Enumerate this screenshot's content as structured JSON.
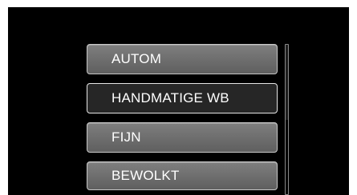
{
  "menu": {
    "items": [
      {
        "label": "AUTOM"
      },
      {
        "label": "HANDMATIGE WB"
      },
      {
        "label": "FIJN"
      },
      {
        "label": "BEWOLKT"
      }
    ],
    "selected_index": 1
  },
  "scrollbar": {
    "position_fraction": 0.0,
    "visible_fraction": 0.5
  },
  "colors": {
    "background": "#000000",
    "item": "#707070",
    "item_selected": "#262626",
    "text": "#ffffff"
  }
}
